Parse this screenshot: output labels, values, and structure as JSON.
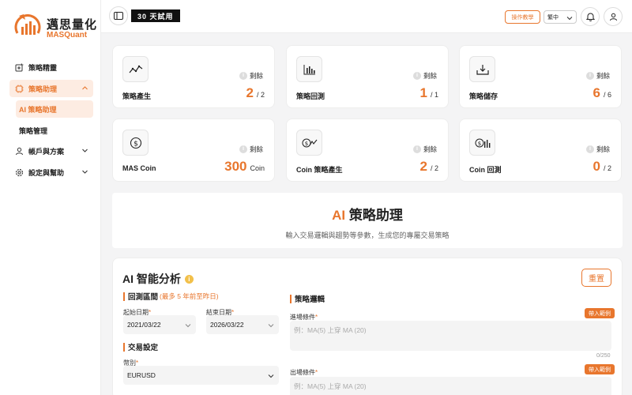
{
  "brand": {
    "name": "邁思量化",
    "sub": "MASQuant",
    "accent": "#e8762d"
  },
  "header": {
    "trial_label": "30 天試用",
    "tutorial_label": "操作教學",
    "language": "繁中",
    "icons": [
      "sidebar-toggle-icon",
      "bell-icon",
      "user-icon"
    ]
  },
  "sidebar": {
    "items": [
      {
        "label": "策略精靈",
        "icon": "wizard-icon"
      },
      {
        "label": "策略助理",
        "icon": "assistant-icon"
      },
      {
        "label": "帳戶與方案",
        "icon": "user-icon"
      },
      {
        "label": "設定與幫助",
        "icon": "gear-icon"
      }
    ],
    "sub_items": [
      {
        "label": "AI 策略助理"
      },
      {
        "label": "策略管理"
      }
    ]
  },
  "stats": [
    {
      "label": "策略產生",
      "remain": "剩餘",
      "value": "2",
      "total": "/ 2",
      "icon": "line-trend-icon"
    },
    {
      "label": "策略回測",
      "remain": "剩餘",
      "value": "1",
      "total": "/ 1",
      "icon": "bar-chart-icon"
    },
    {
      "label": "策略儲存",
      "remain": "剩餘",
      "value": "6",
      "total": "/ 6",
      "icon": "download-tray-icon"
    },
    {
      "label": "MAS Coin",
      "remain": "剩餘",
      "value": "300",
      "total": "Coin",
      "icon": "dollar-coin-icon"
    },
    {
      "label": "Coin 策略產生",
      "remain": "剩餘",
      "value": "2",
      "total": "/ 2",
      "icon": "coin-trend-icon"
    },
    {
      "label": "Coin 回測",
      "remain": "剩餘",
      "value": "0",
      "total": "/ 2",
      "icon": "coin-bars-icon"
    }
  ],
  "banner": {
    "title_ai": "AI",
    "title_rest": " 策略助理",
    "subtitle": "輸入交易邏輯與趨勢等參數，生成您的專屬交易策略"
  },
  "panel": {
    "title": "AI 智能分析",
    "reset_label": "重置",
    "backtest": {
      "title": "回測區間",
      "hint": "(最多 5 年前至昨日)",
      "start_label": "起始日期",
      "start_value": "2021/03/22",
      "end_label": "結束日期",
      "end_value": "2026/03/22"
    },
    "trade": {
      "title": "交易設定",
      "currency_label": "幣別",
      "currency_value": "EURUSD"
    },
    "logic": {
      "title": "策略邏輯",
      "entry_label": "進場條件",
      "entry_placeholder": "例：MA(5) 上穿 MA (20)",
      "entry_counter": "0/250",
      "exit_label": "出場條件",
      "exit_placeholder": "例：MA(5) 上穿 MA (20)",
      "insert_label": "帶入範例"
    }
  }
}
